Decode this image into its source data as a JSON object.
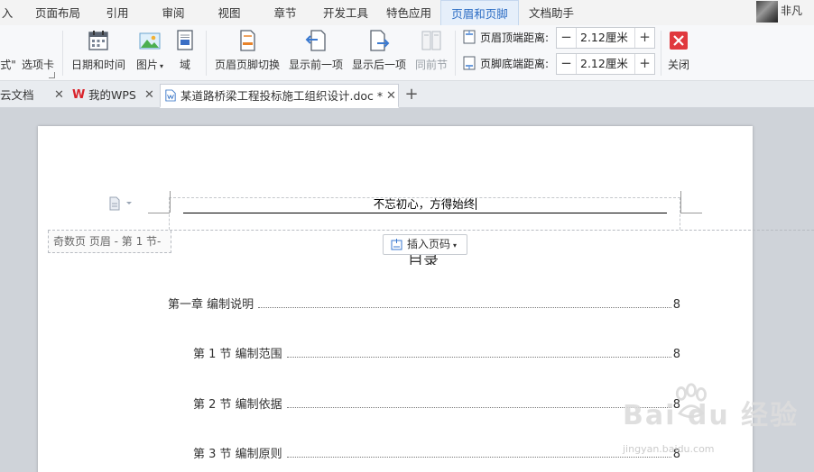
{
  "menu": {
    "tabs": [
      {
        "label": "入"
      },
      {
        "label": "页面布局"
      },
      {
        "label": "引用"
      },
      {
        "label": "审阅"
      },
      {
        "label": "视图"
      },
      {
        "label": "章节"
      },
      {
        "label": "开发工具"
      },
      {
        "label": "特色应用"
      },
      {
        "label": "页眉和页脚",
        "active": true
      },
      {
        "label": "文档助手"
      }
    ],
    "username": "非凡"
  },
  "ribbon": {
    "partial_left_1": "式\"",
    "options_tab": "选项卡",
    "datetime": "日期和时间",
    "picture": "图片",
    "field": "域",
    "switch_header_footer": "页眉页脚切换",
    "show_prev": "显示前一项",
    "show_next": "显示后一项",
    "same_as_prev": "同前节",
    "header_top_distance_label": "页眉顶端距离:",
    "header_top_distance_value": "2.12厘米",
    "footer_bottom_distance_label": "页脚底端距离:",
    "footer_bottom_distance_value": "2.12厘米",
    "close": "关闭"
  },
  "doc_tabs": {
    "cloud_docs": "云文档",
    "my_wps": "我的WPS",
    "current_doc": "某道路桥梁工程投标施工组织设计.doc *"
  },
  "document": {
    "header_text": "不忘初心，方得始终",
    "odd_page_label": "奇数页 页眉  - 第 1 节-",
    "insert_page_number": "插入页码",
    "toc_title": "目录",
    "toc": [
      {
        "text": "第一章  编制说明",
        "page": "8"
      },
      {
        "text": "第 1 节  编制范围",
        "page": "8"
      },
      {
        "text": "第 2 节  编制依据",
        "page": "8"
      },
      {
        "text": "第 3 节  编制原则",
        "page": "8"
      }
    ]
  },
  "watermark": {
    "brand": "Bai du 经验",
    "url": "jingyan.baidu.com"
  },
  "colors": {
    "accent": "#2b6cc4",
    "close_red": "#e0393e",
    "wps_red": "#d9232b"
  }
}
